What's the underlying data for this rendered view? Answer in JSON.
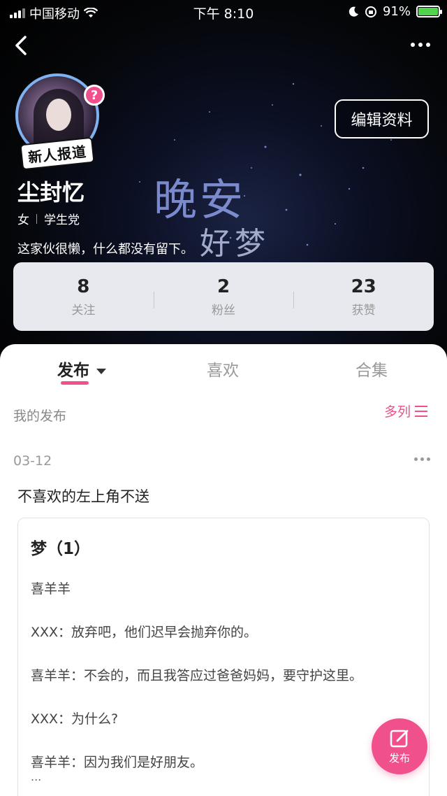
{
  "status_bar": {
    "carrier": "中国移动",
    "time": "下午 8:10",
    "battery": "91%"
  },
  "profile": {
    "username": "尘封忆",
    "gender": "女",
    "identity": "学生党",
    "bio": "这家伙很懒，什么都没有留下。",
    "new_badge": "新人报道",
    "question_badge": "?",
    "edit_button": "编辑资料",
    "background_text_1": "晚安",
    "background_text_2": "好梦"
  },
  "stats": [
    {
      "value": "8",
      "label": "关注"
    },
    {
      "value": "2",
      "label": "粉丝"
    },
    {
      "value": "23",
      "label": "获赞"
    }
  ],
  "tabs": {
    "publish": "发布",
    "like": "喜欢",
    "collection": "合集"
  },
  "section": {
    "title": "我的发布",
    "view_toggle": "多列"
  },
  "post": {
    "date": "03-12",
    "text": "不喜欢的左上角不送",
    "card": {
      "title": "梦（1）",
      "lines": [
        "喜羊羊",
        "XXX：放弃吧，他们迟早会抛弃你的。",
        "喜羊羊：不会的，而且我答应过爸爸妈妈，要守护这里。",
        "XXX：为什么?",
        "喜羊羊：因为我们是好朋友。"
      ],
      "ellipsis": "..."
    }
  },
  "fab": {
    "label": "发布"
  },
  "colors": {
    "accent": "#f0508c",
    "stats_bg": "#e8e9ef"
  }
}
